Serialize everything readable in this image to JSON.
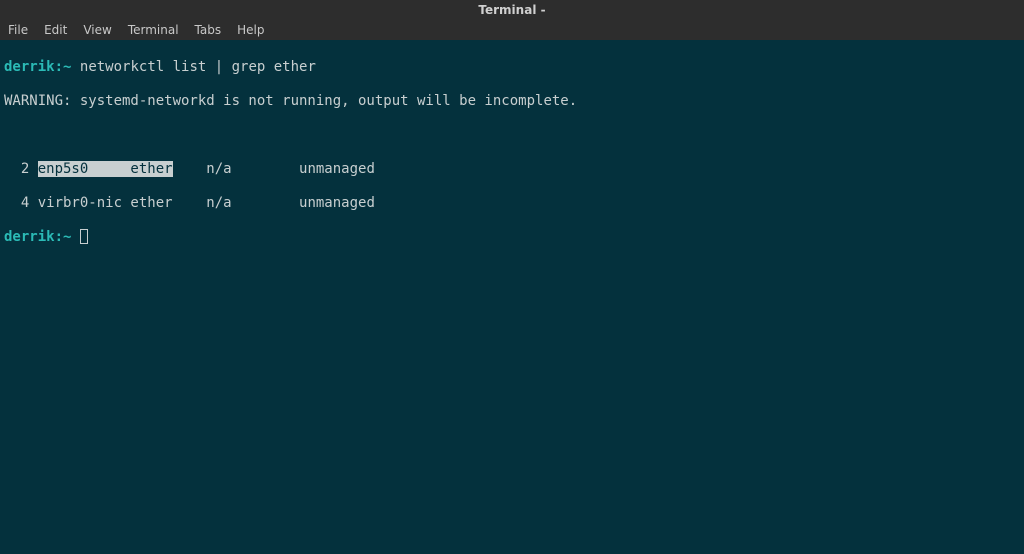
{
  "titlebar": {
    "title": "Terminal -"
  },
  "menubar": {
    "items": [
      "File",
      "Edit",
      "View",
      "Terminal",
      "Tabs",
      "Help"
    ]
  },
  "terminal": {
    "prompt_host": "derrik:",
    "prompt_path": "~",
    "command": "networkctl list | grep ether",
    "warning": "WARNING: systemd-networkd is not running, output will be incomplete.",
    "row1": {
      "idx": "  2 ",
      "highlighted": "enp5s0     ether",
      "rest": "    n/a        unmanaged"
    },
    "row2": {
      "idx": "  4 ",
      "text": "virbr0-nic ether    n/a        unmanaged"
    }
  }
}
